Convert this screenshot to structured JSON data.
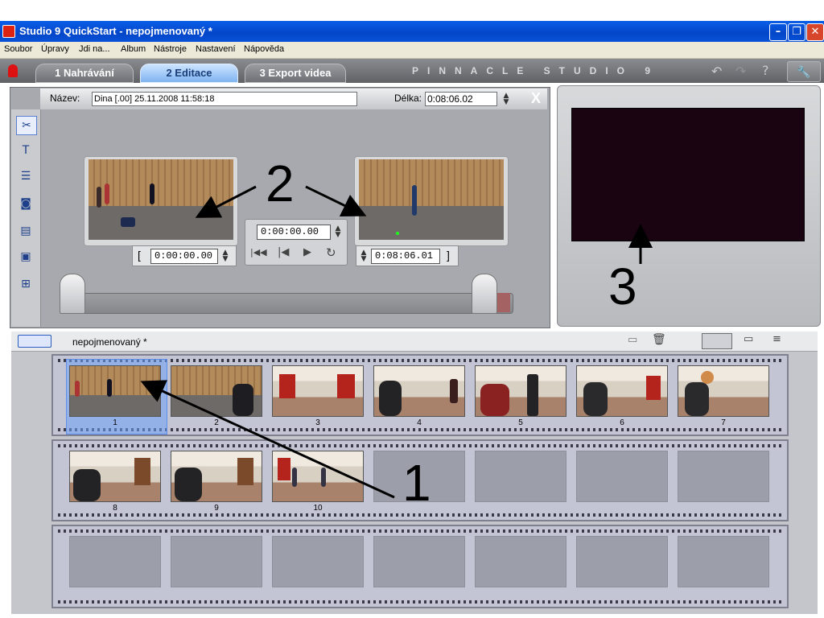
{
  "window": {
    "title": "Studio 9 QuickStart - nepojmenovaný *"
  },
  "menu": [
    "Soubor",
    "Úpravy",
    "Jdi na...",
    "Album",
    "Nástroje",
    "Nastavení",
    "Nápověda"
  ],
  "tabs": [
    {
      "label": "1 Nahrávání",
      "active": false
    },
    {
      "label": "2 Editace",
      "active": true
    },
    {
      "label": "3 Export videa",
      "active": false
    }
  ],
  "brand": "PINNACLE STUDIO 9",
  "editor": {
    "name_label": "Název:",
    "name_value": "Dina [.00]  25.11.2008 11:58:18",
    "length_label": "Délka:",
    "length_value": "0:08:06.02",
    "close_label": "X",
    "in_time": "0:00:00.00",
    "current_time": "0:00:00.00",
    "out_time": "0:08:06.01",
    "bracket_open": "[",
    "bracket_close": "]"
  },
  "album": {
    "title": "nepojmenovaný *",
    "clips": [
      "1",
      "2",
      "3",
      "4",
      "5",
      "6",
      "7",
      "8",
      "9",
      "10"
    ],
    "selected_clip": "1"
  },
  "annotations": [
    "1",
    "2",
    "3"
  ],
  "colors": {
    "accent": "#7fb4f0",
    "title_bar": "#0a5ee8",
    "preview_screen": "#1a0411"
  }
}
